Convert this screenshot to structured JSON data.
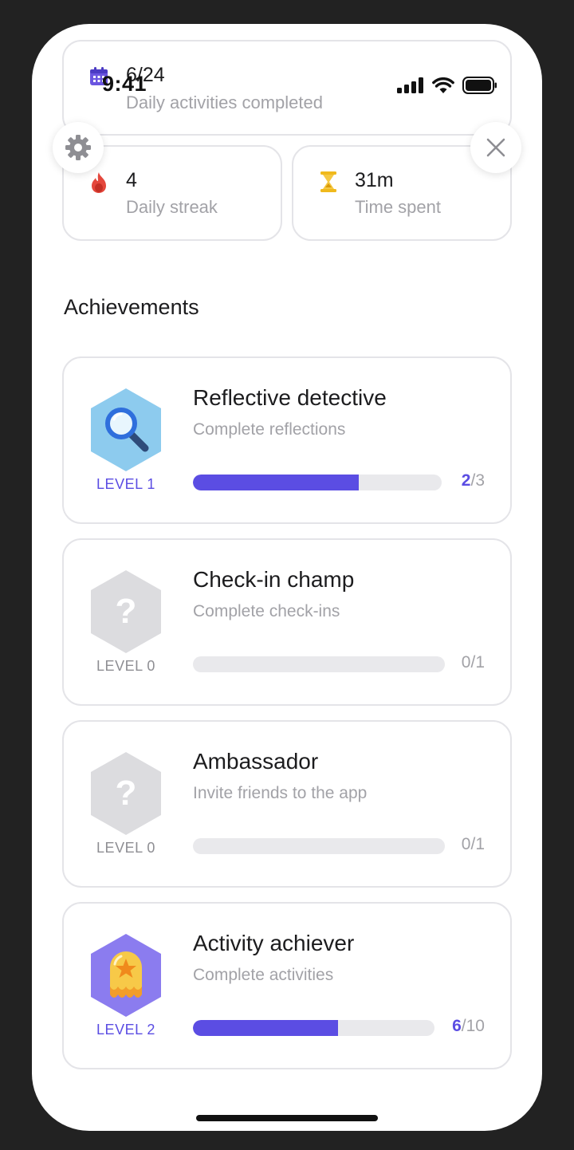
{
  "status_bar": {
    "time": "9:41"
  },
  "stats": {
    "daily": {
      "value": "6/24",
      "label": "Daily activities completed",
      "icon": "calendar-icon"
    },
    "streak": {
      "value": "4",
      "label": "Daily streak",
      "icon": "fire-icon"
    },
    "time": {
      "value": "31m",
      "label": "Time spent",
      "icon": "hourglass-icon"
    }
  },
  "controls": {
    "settings_icon": "gear-icon",
    "close_icon": "close-icon"
  },
  "section_title": "Achievements",
  "achievements": [
    {
      "title": "Reflective detective",
      "subtitle": "Complete reflections",
      "level": "LEVEL 1",
      "current": "2",
      "total": "/3",
      "progress": 0.667,
      "badge": "magnifier-badge",
      "locked": false
    },
    {
      "title": "Check-in champ",
      "subtitle": "Complete check-ins",
      "level": "LEVEL 0",
      "current": "0",
      "total": "/1",
      "progress": 0,
      "badge": "locked-badge",
      "locked": true
    },
    {
      "title": "Ambassador",
      "subtitle": "Invite friends to the app",
      "level": "LEVEL 0",
      "current": "0",
      "total": "/1",
      "progress": 0,
      "badge": "locked-badge",
      "locked": true
    },
    {
      "title": "Activity achiever",
      "subtitle": "Complete activities",
      "level": "LEVEL 2",
      "current": "6",
      "total": "/10",
      "progress": 0.6,
      "badge": "star-medal-badge",
      "locked": false
    }
  ],
  "colors": {
    "accent": "#5b4de3",
    "muted": "#a2a2a7",
    "track": "#e9e9ec",
    "border": "#e4e4e8",
    "locked": "#dcdcdf"
  }
}
